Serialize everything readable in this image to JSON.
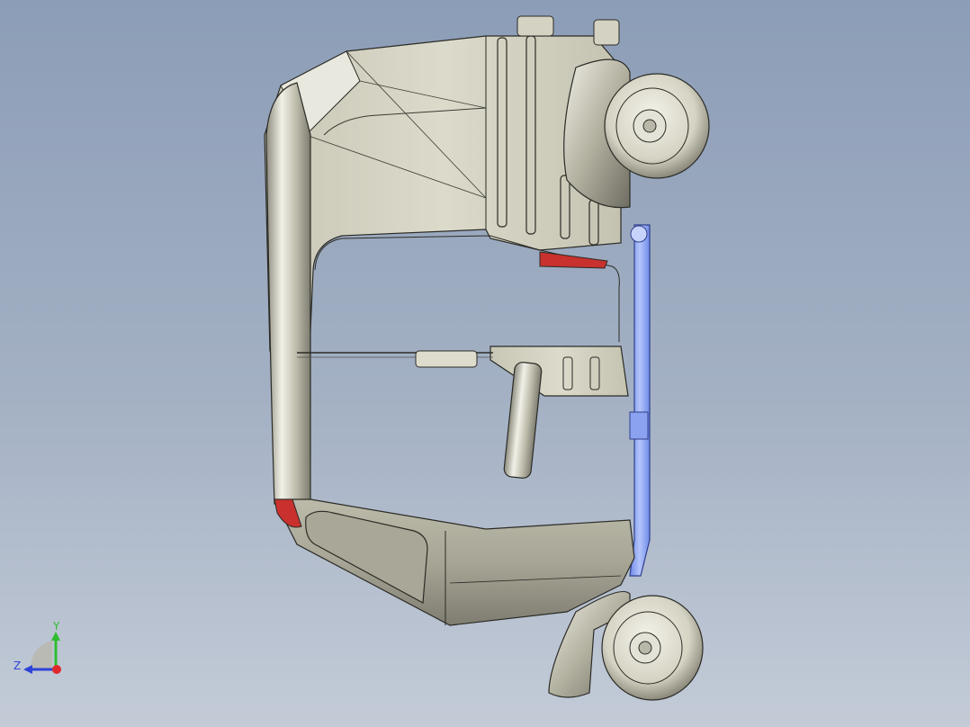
{
  "viewport": {
    "background_top": "#8c9db7",
    "background_bottom": "#c3cbd7"
  },
  "model": {
    "body_color": "#d6d4c4",
    "selected_part_color": "#9eb4f5",
    "tail_light_color": "#c8312d"
  },
  "triad": {
    "x_color": "#e0282a",
    "y_color": "#2fbd2f",
    "z_color": "#2f43d8",
    "y_label": "Y",
    "z_label": "Z"
  }
}
